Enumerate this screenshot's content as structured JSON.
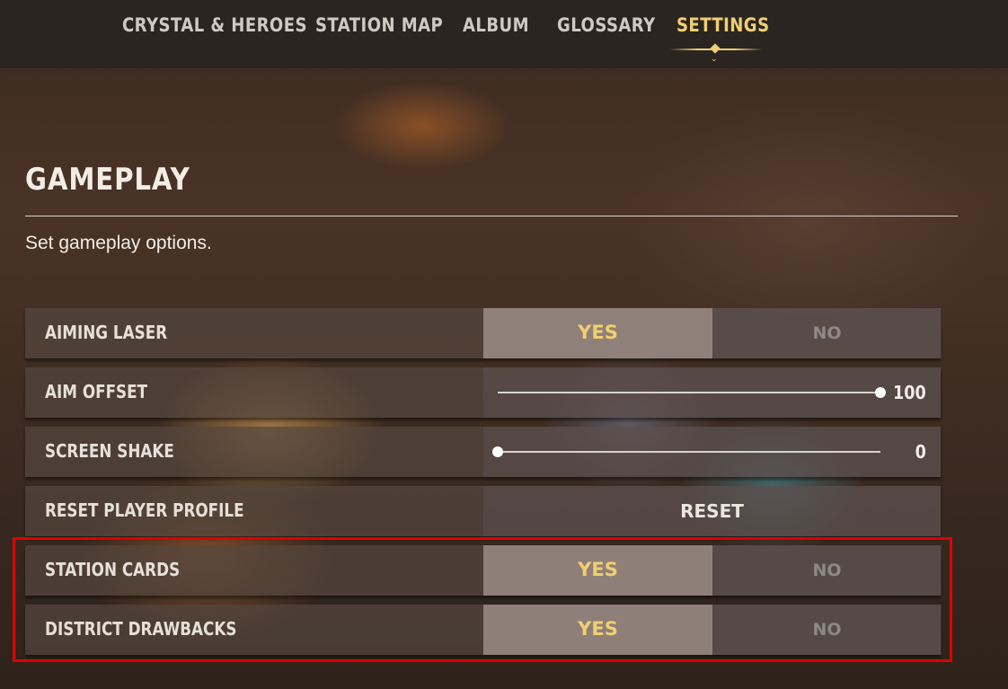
{
  "nav": {
    "tabs": [
      {
        "label": "CRYSTAL & HEROES",
        "active": false
      },
      {
        "label": "STATION MAP",
        "active": false
      },
      {
        "label": "ALBUM",
        "active": false
      },
      {
        "label": "GLOSSARY",
        "active": false
      },
      {
        "label": "SETTINGS",
        "active": true
      }
    ]
  },
  "section": {
    "title": "GAMEPLAY",
    "subtitle": "Set gameplay options."
  },
  "settings": {
    "aiming_laser": {
      "label": "AIMING LASER",
      "yes": "YES",
      "no": "NO",
      "selected": "YES"
    },
    "aim_offset": {
      "label": "AIM OFFSET",
      "value": "100",
      "level": 1.0
    },
    "screen_shake": {
      "label": "SCREEN SHAKE",
      "value": "0",
      "level": 0.0
    },
    "reset_profile": {
      "label": "RESET PLAYER PROFILE",
      "button": "RESET"
    },
    "station_cards": {
      "label": "STATION CARDS",
      "yes": "YES",
      "no": "NO",
      "selected": "YES"
    },
    "district_drawbacks": {
      "label": "DISTRICT DRAWBACKS",
      "yes": "YES",
      "no": "NO",
      "selected": "YES"
    }
  },
  "colors": {
    "accent": "#f0cf73",
    "highlight": "#e00000"
  }
}
